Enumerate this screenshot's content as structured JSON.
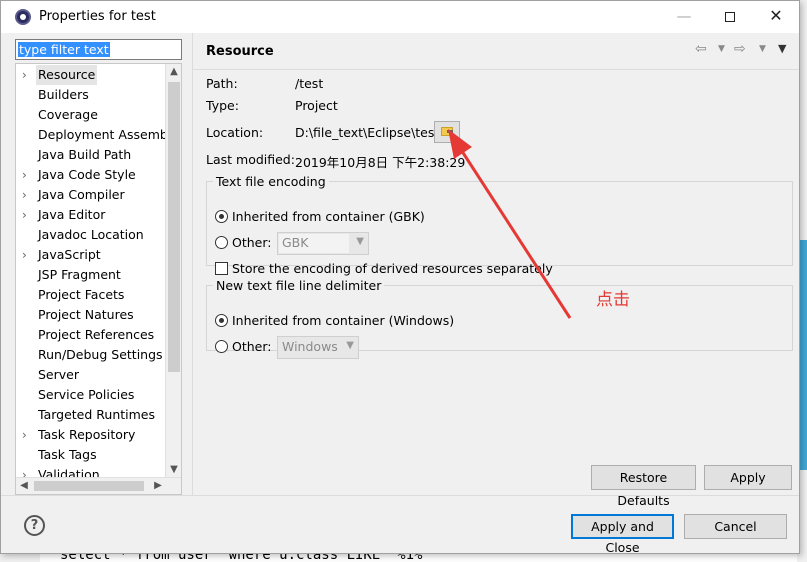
{
  "window": {
    "title": "Properties for test"
  },
  "filter": {
    "text": "type filter text"
  },
  "tree": {
    "items": [
      {
        "label": "Resource",
        "chevron": true,
        "selected": true
      },
      {
        "label": "Builders",
        "chevron": false
      },
      {
        "label": "Coverage",
        "chevron": false
      },
      {
        "label": "Deployment Assembly",
        "chevron": false
      },
      {
        "label": "Java Build Path",
        "chevron": false
      },
      {
        "label": "Java Code Style",
        "chevron": true
      },
      {
        "label": "Java Compiler",
        "chevron": true
      },
      {
        "label": "Java Editor",
        "chevron": true
      },
      {
        "label": "Javadoc Location",
        "chevron": false
      },
      {
        "label": "JavaScript",
        "chevron": true
      },
      {
        "label": "JSP Fragment",
        "chevron": false
      },
      {
        "label": "Project Facets",
        "chevron": false
      },
      {
        "label": "Project Natures",
        "chevron": false
      },
      {
        "label": "Project References",
        "chevron": false
      },
      {
        "label": "Run/Debug Settings",
        "chevron": false
      },
      {
        "label": "Server",
        "chevron": false
      },
      {
        "label": "Service Policies",
        "chevron": false
      },
      {
        "label": "Targeted Runtimes",
        "chevron": false
      },
      {
        "label": "Task Repository",
        "chevron": true
      },
      {
        "label": "Task Tags",
        "chevron": false
      },
      {
        "label": "Validation",
        "chevron": true
      }
    ]
  },
  "page": {
    "title": "Resource",
    "path_label": "Path:",
    "path_value": "/test",
    "type_label": "Type:",
    "type_value": "Project",
    "location_label": "Location:",
    "location_value": "D:\\file_text\\Eclipse\\test",
    "modified_label": "Last modified:",
    "modified_value": "2019年10月8日 下午2:38:29"
  },
  "encoding": {
    "legend": "Text file encoding",
    "inherited": "Inherited from container (GBK)",
    "other": "Other:",
    "other_value": "GBK",
    "store": "Store the encoding of derived resources separately"
  },
  "delimiter": {
    "legend": "New text file line delimiter",
    "inherited": "Inherited from container (Windows)",
    "other": "Other:",
    "other_value": "Windows"
  },
  "buttons": {
    "restore": "Restore Defaults",
    "apply": "Apply",
    "apply_close": "Apply and Close",
    "cancel": "Cancel",
    "help": "?"
  },
  "annotation": {
    "text": "点击",
    "color": "#e53935"
  },
  "background_code": "select * from user  where u.class LIKE '%1%'"
}
